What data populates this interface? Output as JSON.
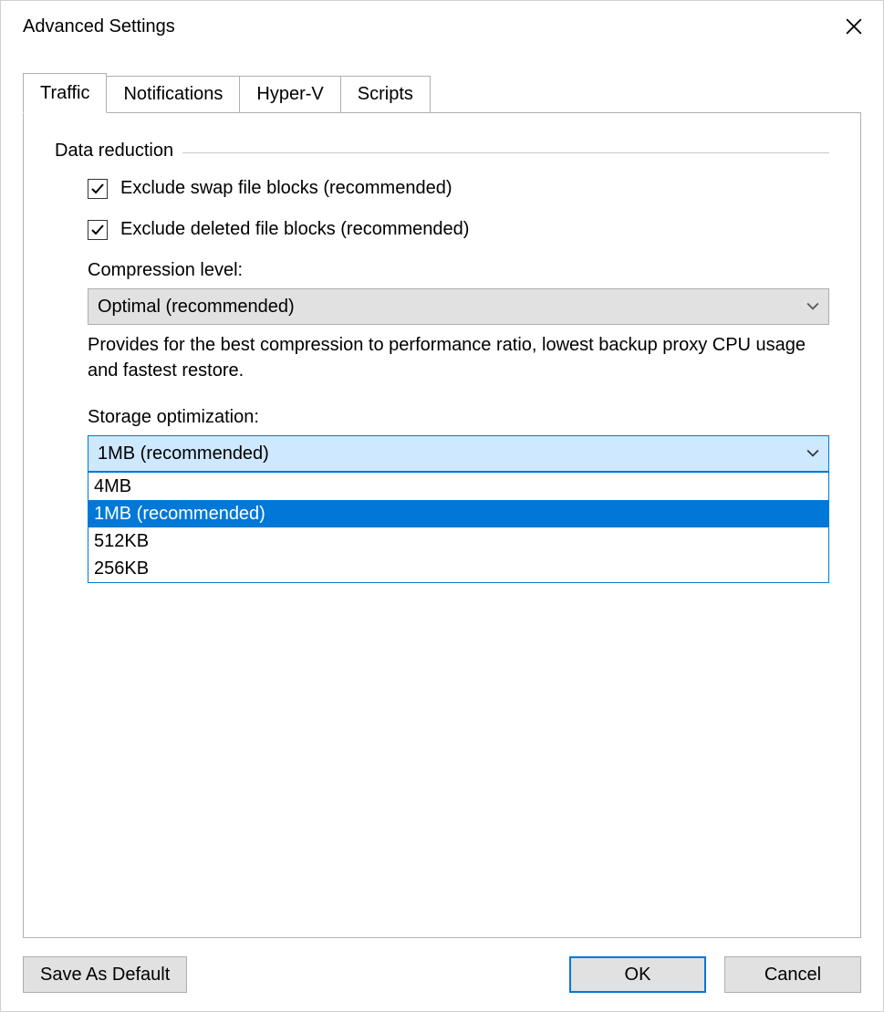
{
  "window": {
    "title": "Advanced Settings"
  },
  "tabs": {
    "t0": "Traffic",
    "t1": "Notifications",
    "t2": "Hyper-V",
    "t3": "Scripts"
  },
  "group": {
    "title": "Data reduction"
  },
  "checks": {
    "swap": "Exclude swap file blocks (recommended)",
    "deleted": "Exclude deleted file blocks (recommended)"
  },
  "compression": {
    "label": "Compression level:",
    "value": "Optimal (recommended)",
    "help": "Provides for the best compression to performance ratio, lowest backup proxy CPU usage and fastest restore."
  },
  "storage": {
    "label": "Storage optimization:",
    "value": "1MB (recommended)",
    "options": {
      "o0": "4MB",
      "o1": "1MB (recommended)",
      "o2": "512KB",
      "o3": "256KB"
    }
  },
  "buttons": {
    "save": "Save As Default",
    "ok": "OK",
    "cancel": "Cancel"
  }
}
